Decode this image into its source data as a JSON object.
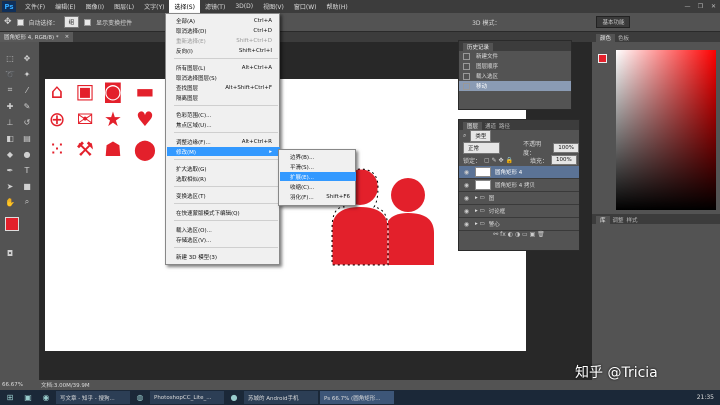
{
  "app": {
    "logo": "Ps"
  },
  "menubar": [
    "文件(F)",
    "编辑(E)",
    "图像(I)",
    "图层(L)",
    "文字(Y)",
    "选择(S)",
    "滤镜(T)",
    "3D(D)",
    "视图(V)",
    "窗口(W)",
    "帮助(H)"
  ],
  "window_controls": [
    "—",
    "❐",
    "✕"
  ],
  "options": {
    "auto_select_label": "自动选择：",
    "auto_select_value": "组",
    "show_transform": "显示变换控件",
    "mode_3d": "3D 模式：",
    "workspace": "基本功能"
  },
  "doc_tab": {
    "title": "圆角矩形 4, RGB/8) *",
    "close": "×"
  },
  "select_menu": [
    {
      "label": "全部(A)",
      "shortcut": "Ctrl+A"
    },
    {
      "label": "取消选择(D)",
      "shortcut": "Ctrl+D"
    },
    {
      "label": "重新选择(E)",
      "shortcut": "Shift+Ctrl+D"
    },
    {
      "label": "反向(I)",
      "shortcut": "Shift+Ctrl+I"
    },
    {
      "label": "所有图层(L)",
      "shortcut": "Alt+Ctrl+A"
    },
    {
      "label": "取消选择图层(S)",
      "shortcut": ""
    },
    {
      "label": "查找图层",
      "shortcut": "Alt+Shift+Ctrl+F"
    },
    {
      "label": "隔离图层",
      "shortcut": ""
    },
    {
      "label": "色彩范围(C)...",
      "shortcut": ""
    },
    {
      "label": "焦点区域(U)...",
      "shortcut": ""
    },
    {
      "label": "调整边缘(F)...",
      "shortcut": "Alt+Ctrl+R"
    },
    {
      "label": "修改(M)",
      "shortcut": "▸"
    },
    {
      "label": "扩大选取(G)",
      "shortcut": ""
    },
    {
      "label": "选取相似(R)",
      "shortcut": ""
    },
    {
      "label": "变换选区(T)",
      "shortcut": ""
    },
    {
      "label": "在快速蒙版模式下编辑(Q)",
      "shortcut": ""
    },
    {
      "label": "载入选区(O)...",
      "shortcut": ""
    },
    {
      "label": "存储选区(V)...",
      "shortcut": ""
    },
    {
      "label": "新建 3D 模型(3)",
      "shortcut": ""
    }
  ],
  "modify_submenu": [
    {
      "label": "边界(B)...",
      "shortcut": ""
    },
    {
      "label": "平滑(S)...",
      "shortcut": ""
    },
    {
      "label": "扩展(E)...",
      "shortcut": ""
    },
    {
      "label": "收缩(C)...",
      "shortcut": ""
    },
    {
      "label": "羽化(F)...",
      "shortcut": "Shift+F6"
    }
  ],
  "history": {
    "tabs": [
      "历史记录"
    ],
    "items": [
      "新建文件",
      "图层顺序",
      "载入选区",
      "移动"
    ]
  },
  "color_panel": {
    "tabs": [
      "颜色",
      "色板"
    ]
  },
  "adjust_panel": {
    "tabs": [
      "库",
      "调整",
      "样式"
    ]
  },
  "layers": {
    "tabs": [
      "图层",
      "通道",
      "路径"
    ],
    "filter": "类型",
    "blend": "正常",
    "opacity_label": "不透明度：",
    "opacity": "100%",
    "lock_label": "锁定：",
    "fill_label": "填充：",
    "fill": "100%",
    "rows": [
      {
        "name": "圆角矩形 4",
        "selected": true
      },
      {
        "name": "圆角矩形 4 拷贝",
        "selected": false
      },
      {
        "name": "图",
        "selected": false
      },
      {
        "name": "讨论框",
        "selected": false
      },
      {
        "name": "警心",
        "selected": false
      }
    ]
  },
  "status": {
    "zoom": "66.67%",
    "doc": "文档:3.00M/39.9M"
  },
  "taskbar": {
    "items": [
      "写文章 - 知乎 - 搜狗...",
      "PhotoshopCC_Lite_...",
      "苏城的 Android手机",
      "Ps 66.7% (圆角矩形..."
    ],
    "clock": "21:35"
  },
  "watermark": "知乎 @Tricia",
  "colors": {
    "icon_red": "#e3202b",
    "fg": "#e3202b",
    "highlight": "#3399ff"
  },
  "icons": [
    "home",
    "briefcase",
    "camera",
    "inbox",
    "globe",
    "mail",
    "star",
    "heart",
    "dots-grid",
    "wrench",
    "people",
    "map-pin"
  ]
}
